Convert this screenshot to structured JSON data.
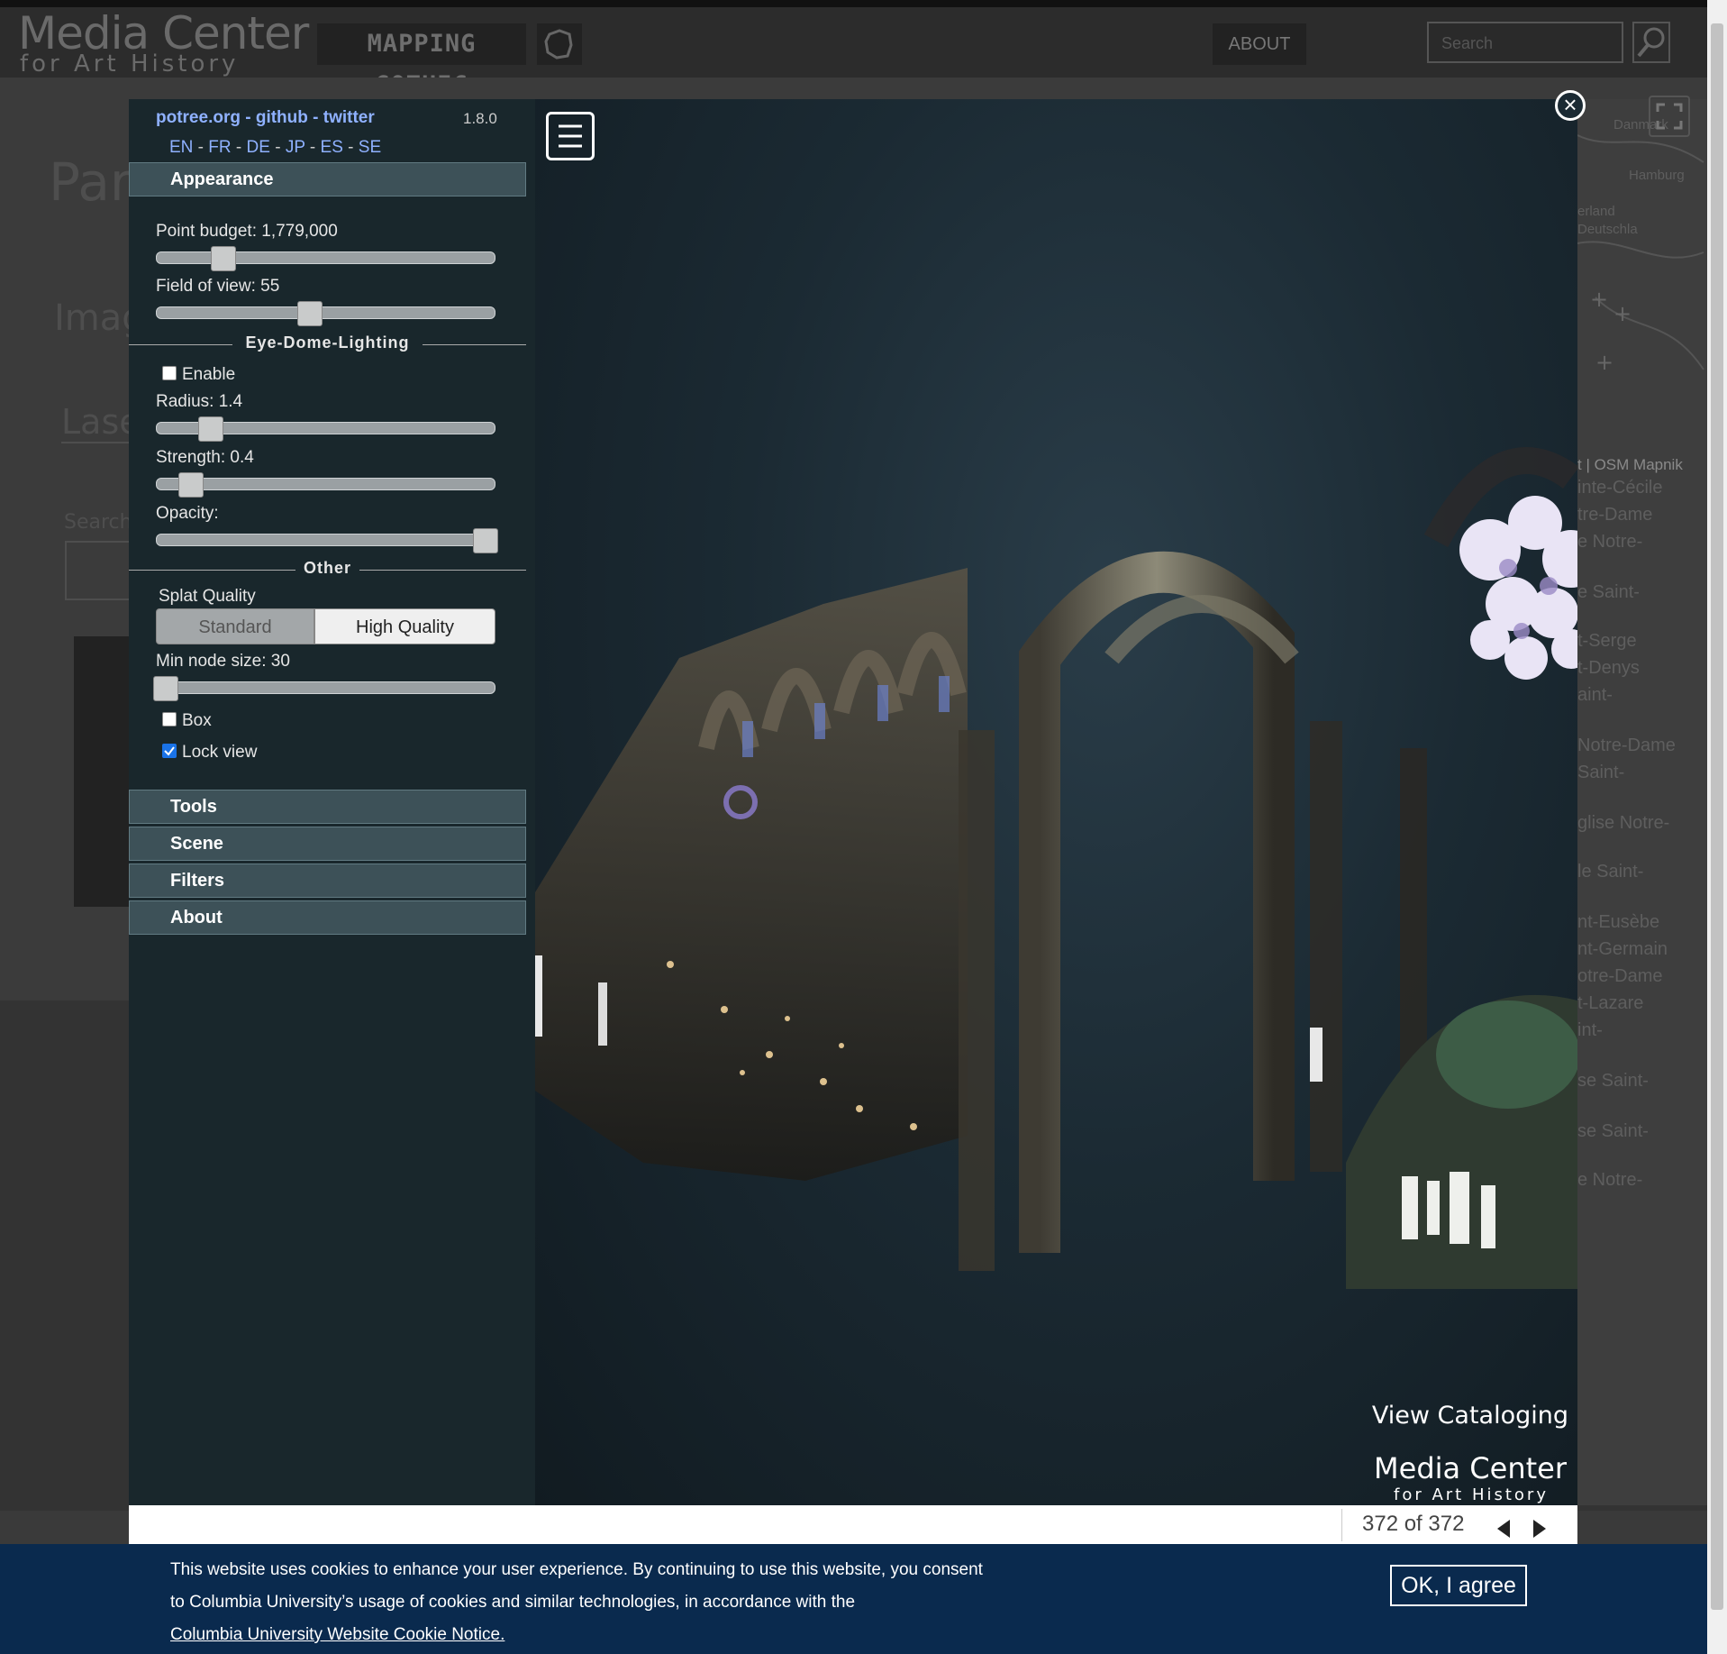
{
  "site": {
    "logo_title": "Media Center",
    "logo_subtitle": "for Art History",
    "mapping_label": "MAPPING GOTHIC",
    "about_label": "ABOUT",
    "search_placeholder": "Search",
    "bg_title": "Paris",
    "bg_images_label": "Image",
    "bg_laser_label": "Laser",
    "bg_search_label": "Search"
  },
  "map_labels": [
    "Danmark",
    "Hamburg",
    "erland",
    "Deutschla",
    "t | OSM Mapnik",
    "inte-Cécile",
    "tre-Dame",
    "e Notre-",
    "e Saint-",
    "t-Serge",
    "t-Denys",
    "aint-",
    "Notre-Dame",
    "Saint-",
    "glise Notre-",
    "le Saint-",
    "nt-Eusèbe",
    "nt-Germain",
    "otre-Dame",
    "t-Lazare",
    "int-",
    "se Saint-",
    "se Saint-",
    "e Notre-"
  ],
  "potree": {
    "links": [
      "potree.org",
      "github",
      "twitter"
    ],
    "version": "1.8.0",
    "languages": [
      "EN",
      "FR",
      "DE",
      "JP",
      "ES",
      "SE"
    ],
    "appearance_label": "Appearance",
    "point_budget_label": "Point budget: 1,779,000",
    "point_budget_level": 0.18,
    "fov_label": "Field of view: 55",
    "fov_level": 0.45,
    "edl_section": "Eye-Dome-Lighting",
    "edl_enable_label": "Enable",
    "edl_enabled": false,
    "radius_label": "Radius: 1.4",
    "radius_level": 0.14,
    "strength_label": "Strength: 0.4",
    "strength_level": 0.08,
    "opacity_label": "Opacity:",
    "opacity_level": 1.0,
    "other_section": "Other",
    "splat_quality_label": "Splat Quality",
    "splat_standard": "Standard",
    "splat_high": "High Quality",
    "splat_selected": "High Quality",
    "min_node_label": "Min node size: 30",
    "min_node_level": 0.0,
    "box_label": "Box",
    "box_checked": false,
    "lock_view_label": "Lock view",
    "lock_view_checked": true,
    "tools_label": "Tools",
    "scene_label": "Scene",
    "filters_label": "Filters",
    "about_label": "About"
  },
  "viewer": {
    "view_cataloging": "View Cataloging",
    "watermark_title": "Media Center",
    "watermark_subtitle": "for Art History"
  },
  "gallery": {
    "counter": "372 of 372"
  },
  "cookie": {
    "text": "This website uses cookies to enhance your user experience. By continuing to use this website, you consent to Columbia University’s usage of cookies and similar technologies, in accordance with the",
    "link_text": "Columbia University Website Cookie Notice.",
    "button_label": "OK, I agree"
  },
  "colors": {
    "sidebar_bg": "#19272c",
    "header_bg": "#3d5158",
    "link": "#8fb1ff",
    "cookie_bg": "#0a2a4e"
  }
}
